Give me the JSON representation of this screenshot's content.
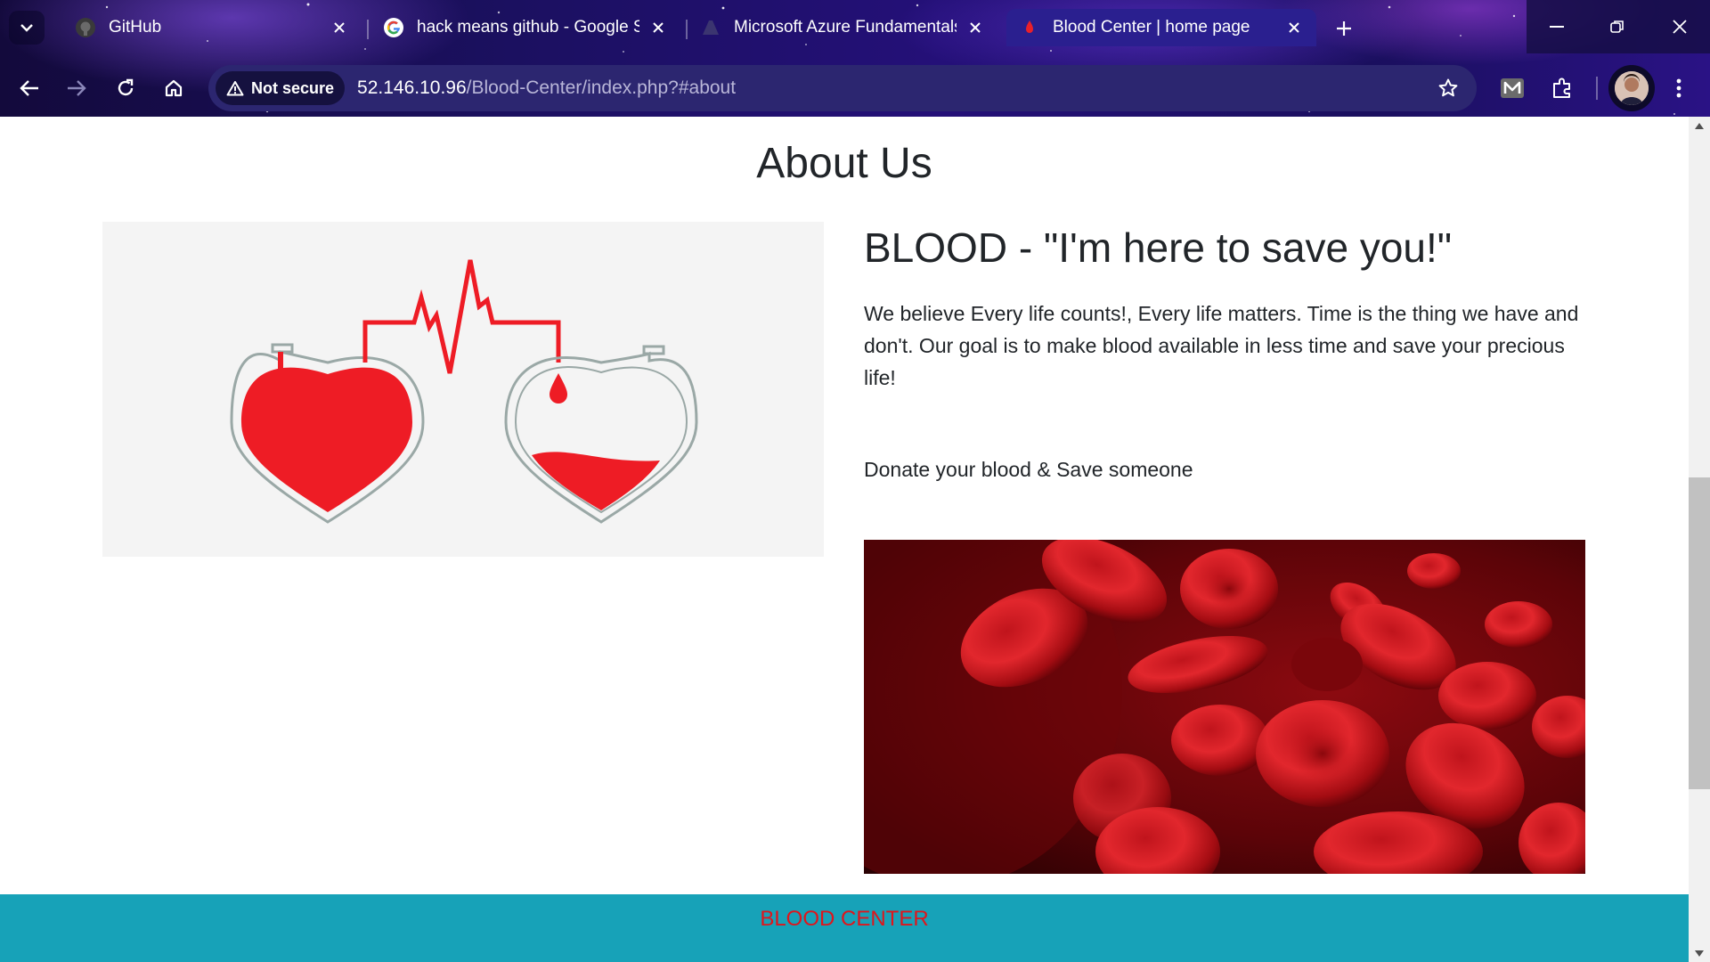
{
  "browser": {
    "tabs": [
      {
        "title": "GitHub",
        "favicon": "github-icon",
        "active": false
      },
      {
        "title": "hack means github - Google S",
        "favicon": "google-icon",
        "active": false
      },
      {
        "title": "Microsoft Azure Fundamentals",
        "favicon": "azure-icon",
        "active": false
      },
      {
        "title": "Blood Center | home page",
        "favicon": "blood-drop-icon",
        "active": true
      }
    ],
    "security_label": "Not secure",
    "url_host": "52.146.10.96",
    "url_path": "/Blood-Center/index.php?#about"
  },
  "page": {
    "section_title": "About Us",
    "slogan": "BLOOD - \"I'm here to save you!\"",
    "about_text": "We believe Every life counts!, Every life matters. Time is the thing we have and don't. Our goal is to make blood available in less time and save your precious life!",
    "donate_line": "Donate your blood & Save someone",
    "footer_label": "BLOOD CENTER"
  },
  "colors": {
    "blood_red": "#e8202a",
    "footer_bg": "#17a2b8",
    "footer_text": "#e0151b",
    "text": "#212529"
  }
}
